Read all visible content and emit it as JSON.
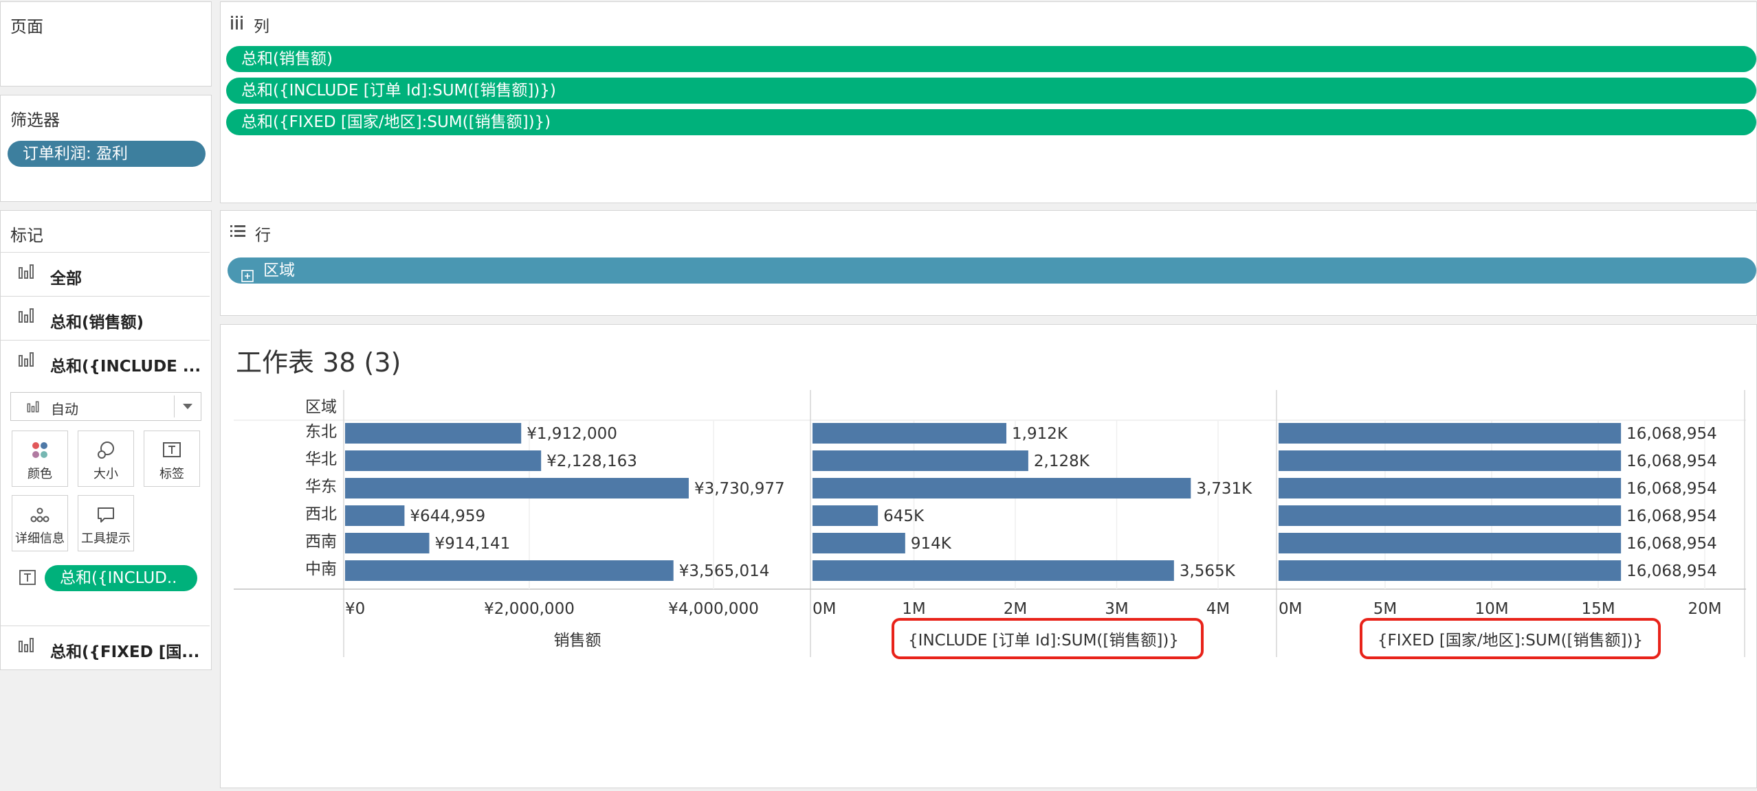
{
  "left_panel": {
    "pages_title": "页面",
    "filters_title": "筛选器",
    "filter_pill": "订单利润: 盈利",
    "marks_title": "标记",
    "mark_rows": [
      "全部",
      "总和(销售额)",
      "总和({INCLUDE ..."
    ],
    "mark_type": "自动",
    "tiles": [
      "颜色",
      "大小",
      "标签",
      "详细信息",
      "工具提示"
    ],
    "label_pill": "总和({INCLUD..",
    "last_mark_row": "总和({FIXED [国..."
  },
  "columns_shelf": {
    "title": "列",
    "pills": [
      "总和(销售额)",
      "总和({INCLUDE [订单 Id]:SUM([销售额])})",
      "总和({FIXED [国家/地区]:SUM([销售额])})"
    ]
  },
  "rows_shelf": {
    "title": "行",
    "pill": "区域"
  },
  "worksheet": {
    "title": "工作表 38 (3)",
    "row_header": "区域",
    "panel_labels": [
      "销售额",
      "{INCLUDE [订单 Id]:SUM([销售额])}",
      "{FIXED [国家/地区]:SUM([销售额])}"
    ]
  },
  "colors": {
    "bar": "#4e79a7",
    "green_pill": "#00b17b",
    "dimension_pill": "#4a97b2",
    "highlight_box": "#e8231a"
  },
  "chart_data": [
    {
      "type": "bar",
      "orientation": "horizontal",
      "categories": [
        "东北",
        "华北",
        "华东",
        "西北",
        "西南",
        "中南"
      ],
      "values": [
        1912000,
        2128163,
        3730977,
        644959,
        914141,
        3565014
      ],
      "data_labels": [
        "¥1,912,000",
        "¥2,128,163",
        "¥3,730,977",
        "¥644,959",
        "¥914,141",
        "¥3,565,014"
      ],
      "xlabel": "销售额",
      "xlim": [
        0,
        4000000
      ],
      "ticks": [
        0,
        2000000,
        4000000
      ],
      "tick_labels": [
        "¥0",
        "¥2,000,000",
        "¥4,000,000"
      ],
      "grid": true
    },
    {
      "type": "bar",
      "orientation": "horizontal",
      "categories": [
        "东北",
        "华北",
        "华东",
        "西北",
        "西南",
        "中南"
      ],
      "values": [
        1912000,
        2128000,
        3731000,
        645000,
        914000,
        3565000
      ],
      "data_labels": [
        "1,912K",
        "2,128K",
        "3,731K",
        "645K",
        "914K",
        "3,565K"
      ],
      "xlabel": "{INCLUDE [订单 Id]:SUM([销售额])}",
      "xlim": [
        0,
        4000000
      ],
      "ticks": [
        0,
        1000000,
        2000000,
        3000000,
        4000000
      ],
      "tick_labels": [
        "0M",
        "1M",
        "2M",
        "3M",
        "4M"
      ],
      "grid": true
    },
    {
      "type": "bar",
      "orientation": "horizontal",
      "categories": [
        "东北",
        "华北",
        "华东",
        "西北",
        "西南",
        "中南"
      ],
      "values": [
        16068954,
        16068954,
        16068954,
        16068954,
        16068954,
        16068954
      ],
      "data_labels": [
        "16,068,954",
        "16,068,954",
        "16,068,954",
        "16,068,954",
        "16,068,954",
        "16,068,954"
      ],
      "xlabel": "{FIXED [国家/地区]:SUM([销售额])}",
      "xlim": [
        0,
        20000000
      ],
      "ticks": [
        0,
        5000000,
        10000000,
        15000000,
        20000000
      ],
      "tick_labels": [
        "0M",
        "5M",
        "10M",
        "15M",
        "20M"
      ],
      "grid": true
    }
  ]
}
